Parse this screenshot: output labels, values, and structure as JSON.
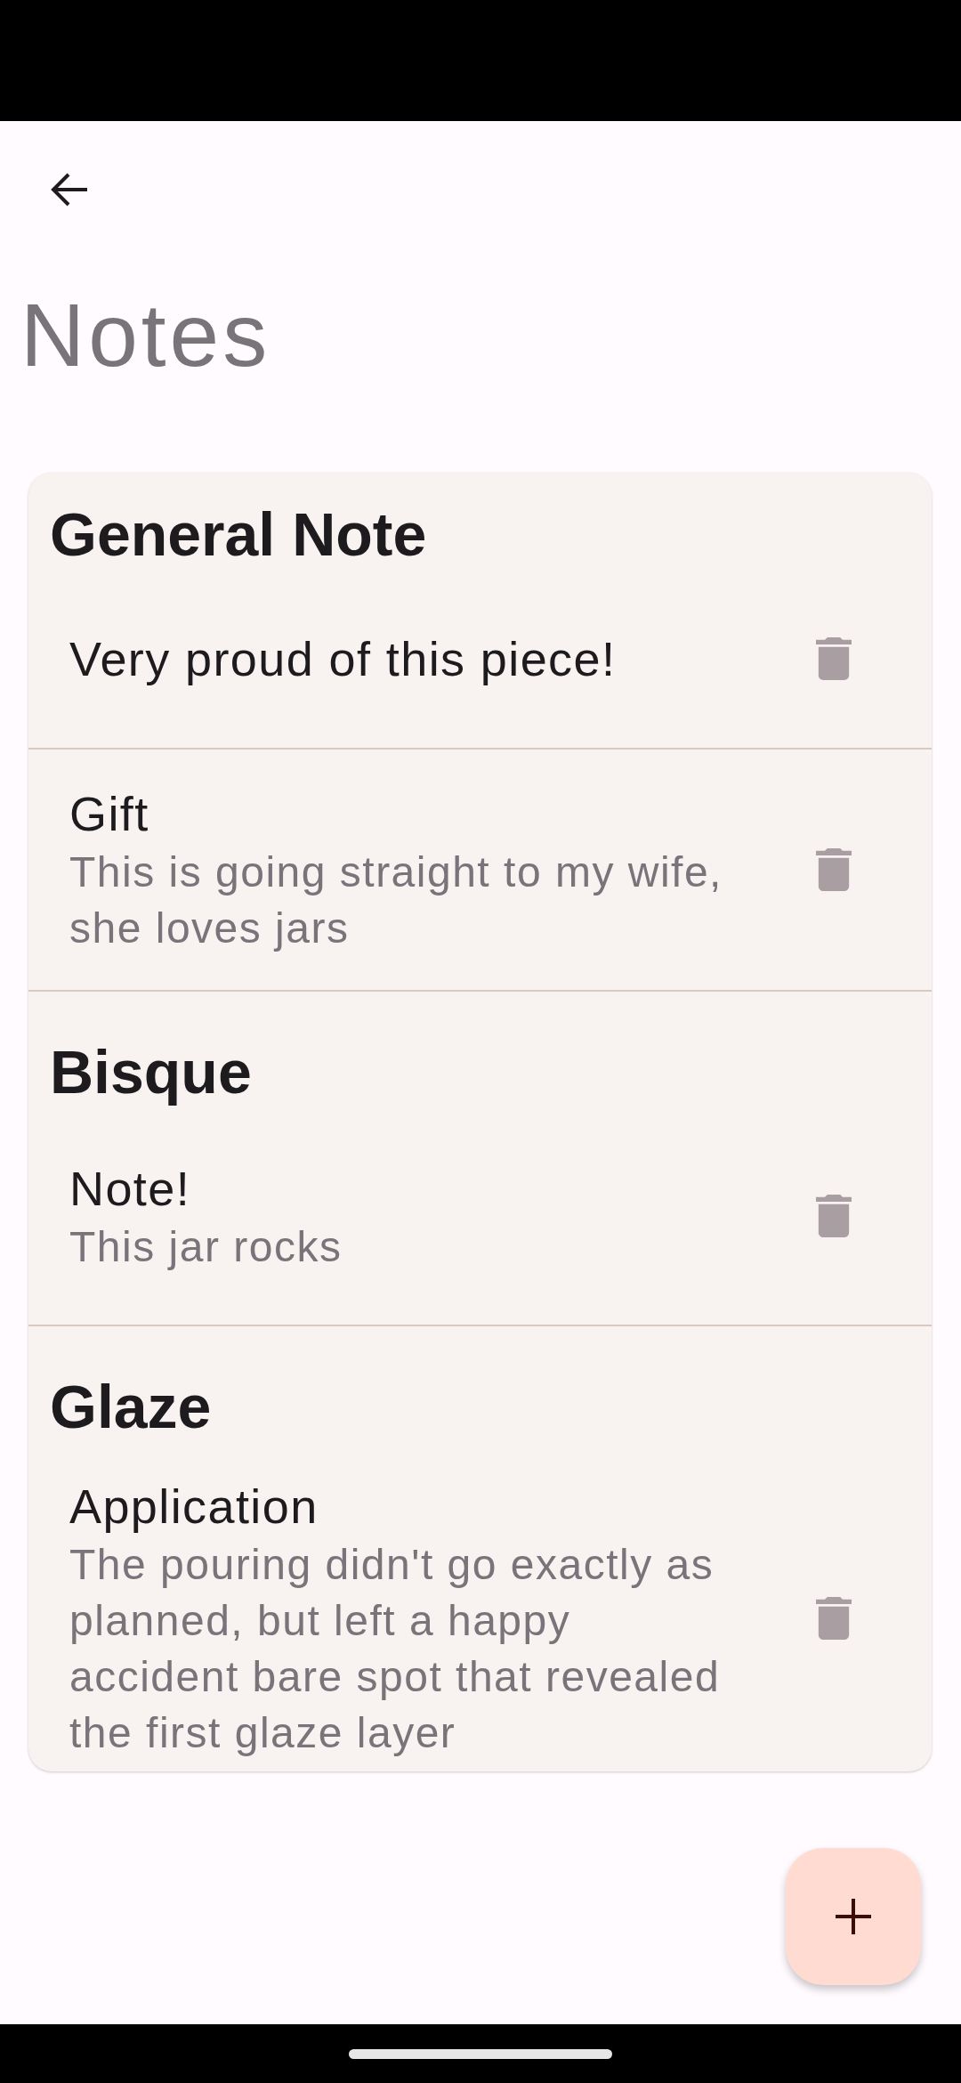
{
  "app_bar": {
    "title": "Notes"
  },
  "sections": [
    {
      "title": "General Note",
      "notes": [
        {
          "title": "Very proud of this piece!"
        },
        {
          "title": "Gift",
          "text": "This is going straight to my wife, she loves jars"
        }
      ]
    },
    {
      "title": "Bisque",
      "notes": [
        {
          "title": "Note!",
          "text": "This jar rocks"
        }
      ]
    },
    {
      "title": "Glaze",
      "notes": [
        {
          "title": "Application",
          "text": "The pouring didn't go exactly as planned, but left a happy accident bare spot that revealed the first glaze layer"
        }
      ]
    }
  ]
}
